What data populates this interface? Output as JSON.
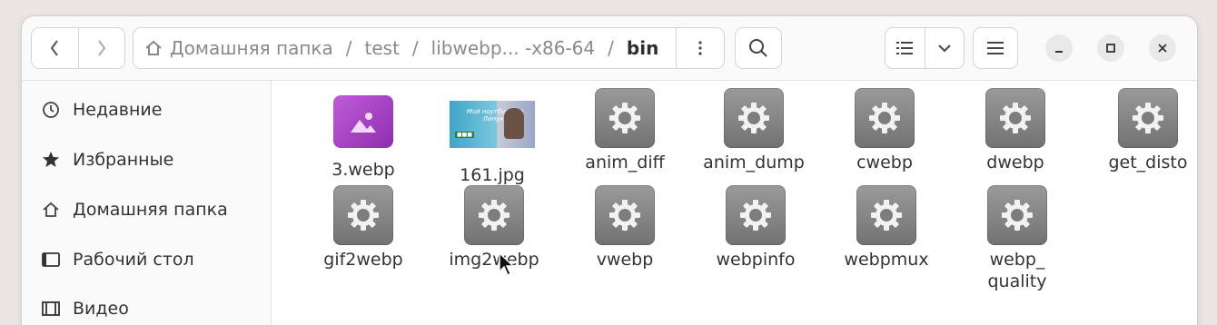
{
  "header": {
    "path": [
      "Домашняя папка",
      "test",
      "libwebp... -x86-64",
      "bin"
    ],
    "separator": "/"
  },
  "sidebar": {
    "items": [
      {
        "label": "Недавние",
        "icon": "clock-icon"
      },
      {
        "label": "Избранные",
        "icon": "star-icon"
      },
      {
        "label": "Домашняя папка",
        "icon": "home-icon"
      },
      {
        "label": "Рабочий стол",
        "icon": "desktop-icon"
      },
      {
        "label": "Видео",
        "icon": "film-icon"
      }
    ]
  },
  "files": [
    {
      "name": "3.webp",
      "kind": "image"
    },
    {
      "name": "161.jpg",
      "kind": "photo",
      "thumb_text": "Мой ноутбук для Линукс"
    },
    {
      "name": "anim_diff",
      "kind": "executable"
    },
    {
      "name": "anim_dump",
      "kind": "executable"
    },
    {
      "name": "cwebp",
      "kind": "executable"
    },
    {
      "name": "dwebp",
      "kind": "executable"
    },
    {
      "name": "get_disto",
      "kind": "executable"
    },
    {
      "name": "gif2webp",
      "kind": "executable"
    },
    {
      "name": "img2webp",
      "kind": "executable"
    },
    {
      "name": "vwebp",
      "kind": "executable"
    },
    {
      "name": "webpinfo",
      "kind": "executable"
    },
    {
      "name": "webpmux",
      "kind": "executable"
    },
    {
      "name": "webp_\nquality",
      "kind": "executable"
    }
  ],
  "colors": {
    "accent_image": "#a947c8",
    "gear_bg": "#858585"
  }
}
